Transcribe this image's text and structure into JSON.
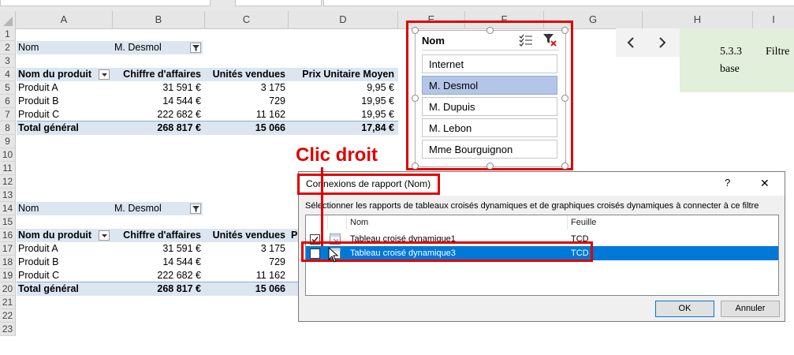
{
  "columns": [
    "A",
    "B",
    "C",
    "D",
    "E",
    "F",
    "G",
    "H",
    "I"
  ],
  "row_numbers": [
    "1",
    "2",
    "3",
    "4",
    "5",
    "6",
    "7",
    "8",
    "9",
    "10",
    "11",
    "12",
    "13",
    "14",
    "15",
    "16",
    "17",
    "18",
    "19",
    "20",
    "21",
    "22",
    "23"
  ],
  "pivot1": {
    "filter_label": "Nom",
    "filter_value": "M. Desmol",
    "headers": [
      "Nom du produit",
      "Chiffre d'affaires",
      "Unités vendues",
      "Prix Unitaire Moyen"
    ],
    "rows": [
      [
        "Produit A",
        "31 591 €",
        "3 175",
        "9,95 €"
      ],
      [
        "Produit B",
        "14 544 €",
        "729",
        "19,95 €"
      ],
      [
        "Produit C",
        "222 682 €",
        "11 162",
        "19,95 €"
      ]
    ],
    "total": [
      "Total général",
      "268 817 €",
      "15 066",
      "17,84 €"
    ]
  },
  "pivot2": {
    "filter_label": "Nom",
    "filter_value": "M. Desmol",
    "headers": [
      "Nom du produit",
      "Chiffre d'affaires",
      "Unités vendues",
      "P"
    ],
    "rows": [
      [
        "Produit A",
        "31 591 €",
        "3 175"
      ],
      [
        "Produit B",
        "14 544 €",
        "729"
      ],
      [
        "Produit C",
        "222 682 €",
        "11 162"
      ]
    ],
    "total": [
      "Total général",
      "268 817 €",
      "15 066"
    ]
  },
  "slicer": {
    "title": "Nom",
    "items": [
      "Internet",
      "M. Desmol",
      "M. Dupuis",
      "M. Lebon",
      "Mme Bourguignon"
    ],
    "selected_index": 1
  },
  "annotation": {
    "label": "Clic droit",
    "color": "#e00000"
  },
  "side_panel": {
    "section_number": "5.3.3",
    "section_text_1": "Filtre",
    "section_text_2": "base"
  },
  "dialog": {
    "title": "Connexions de rapport (Nom)",
    "help_label": "?",
    "close_label": "✕",
    "instruction": "Sélectionner les rapports de tableaux croisés dynamiques et de graphiques croisés dynamiques à connecter à ce filtre",
    "col_name": "Nom",
    "col_sheet": "Feuille",
    "rows": [
      {
        "name": "Tableau croisé dynamique1",
        "sheet": "TCD",
        "checked": true
      },
      {
        "name": "Tableau croisé dynamique3",
        "sheet": "TCD",
        "checked": false
      }
    ],
    "ok_label": "OK",
    "cancel_label": "Annuler"
  },
  "colors": {
    "highlight_red": "#e00000",
    "pivot_band": "#dce6f1",
    "slicer_selected": "#b4c6e7",
    "dialog_selection": "#0078d7"
  }
}
